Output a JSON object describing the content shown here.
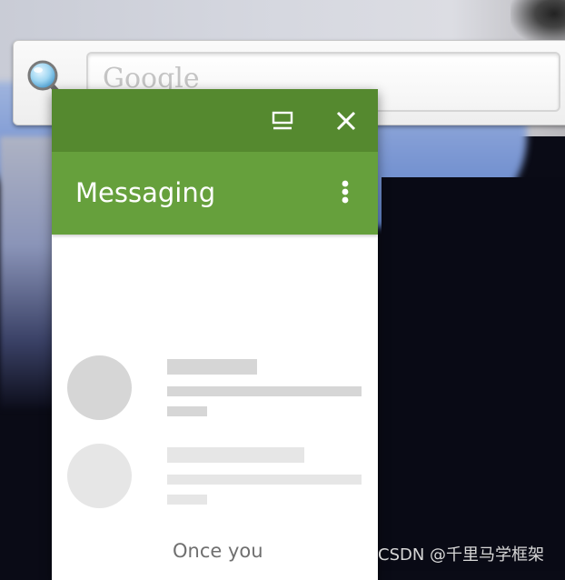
{
  "search_widget": {
    "placeholder": "Google",
    "icon": "search-icon"
  },
  "messaging_window": {
    "window_controls": {
      "minimize_icon": "minimize-icon",
      "close_icon": "close-icon"
    },
    "app_bar": {
      "title": "Messaging",
      "more_icon": "more-vert-icon"
    },
    "loading_placeholder_rows": 2,
    "empty_hint": "Once you"
  },
  "watermark": "CSDN @千里马学框架",
  "colors": {
    "window_bar": "#55892f",
    "app_bar": "#66a03c",
    "skeleton_dark": "#d6d6d6",
    "skeleton_light": "#e6e6e6",
    "wallpaper_dark": "#0a0b16"
  }
}
